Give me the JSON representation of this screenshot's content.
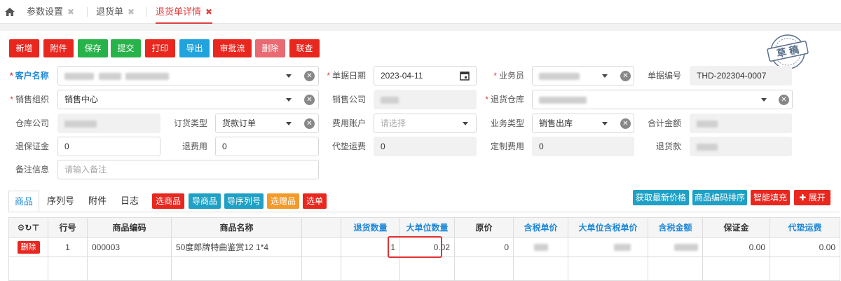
{
  "tabs": [
    {
      "label": "参数设置"
    },
    {
      "label": "退货单"
    },
    {
      "label": "退货单详情"
    }
  ],
  "toolbar": {
    "new": "新增",
    "attach": "附件",
    "save": "保存",
    "submit": "提交",
    "print": "打印",
    "export": "导出",
    "approval": "审批流",
    "delete": "删除",
    "link": "联查"
  },
  "stamp": "草稿",
  "form": {
    "customer_label": "客户名称",
    "date_label": "单据日期",
    "date_value": "2023-04-11",
    "salesman_label": "业务员",
    "docno_label": "单据编号",
    "docno_value": "THD-202304-0007",
    "salesorg_label": "销售组织",
    "salesorg_value": "销售中心",
    "salescompany_label": "销售公司",
    "warehouse_label": "退货仓库",
    "whcompany_label": "仓库公司",
    "ordertype_label": "订货类型",
    "ordertype_value": "货款订单",
    "feeaccount_label": "费用账户",
    "feeaccount_placeholder": "请选择",
    "biztype_label": "业务类型",
    "biztype_value": "销售出库",
    "total_label": "合计金额",
    "deposit_label": "退保证金",
    "deposit_value": "0",
    "fee_label": "退费用",
    "fee_value": "0",
    "freight_label": "代垫运费",
    "freight_value": "0",
    "custom_label": "定制费用",
    "custom_value": "0",
    "refund_label": "退货款",
    "remark_label": "备注信息",
    "remark_placeholder": "请输入备注"
  },
  "detail_tabs": [
    "商品",
    "序列号",
    "附件",
    "日志"
  ],
  "detail_buttons": {
    "select_goods": "选商品",
    "import_goods": "导商品",
    "import_serial": "导序列号",
    "select_gift": "选赠品",
    "select_order": "选单",
    "latest_price": "获取最新价格",
    "sort_code": "商品编码排序",
    "smart_fill": "智能填充",
    "expand": "展开"
  },
  "table": {
    "headers": [
      "行号",
      "商品编码",
      "商品名称",
      "",
      "退货数量",
      "大单位数量",
      "原价",
      "含税单价",
      "大单位含税单价",
      "含税金额",
      "保证金",
      "代垫运费"
    ],
    "rows": [
      {
        "delete": "删除",
        "line": "1",
        "code": "000003",
        "name": "50度郎牌特曲鉴赏12 1*4",
        "qty": "1",
        "big_qty": "0.02",
        "price": "0",
        "deposit": "0.00",
        "freight": "0.00"
      }
    ]
  }
}
